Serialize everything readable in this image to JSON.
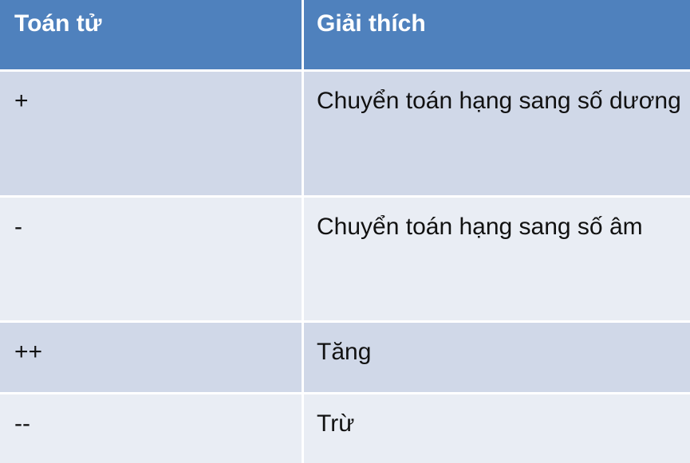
{
  "table": {
    "headers": [
      "Toán tử",
      "Giải thích"
    ],
    "rows": [
      {
        "operator": "+",
        "explanation": "Chuyển toán hạng sang số dương"
      },
      {
        "operator": "-",
        "explanation": "Chuyển toán hạng sang số âm"
      },
      {
        "operator": "++",
        "explanation": "Tăng"
      },
      {
        "operator": "--",
        "explanation": "Trừ"
      }
    ]
  },
  "colors": {
    "header_bg": "#4f81bd",
    "row_dark": "#d0d8e8",
    "row_light": "#e9edf4",
    "header_text": "#ffffff",
    "body_text": "#111111"
  }
}
